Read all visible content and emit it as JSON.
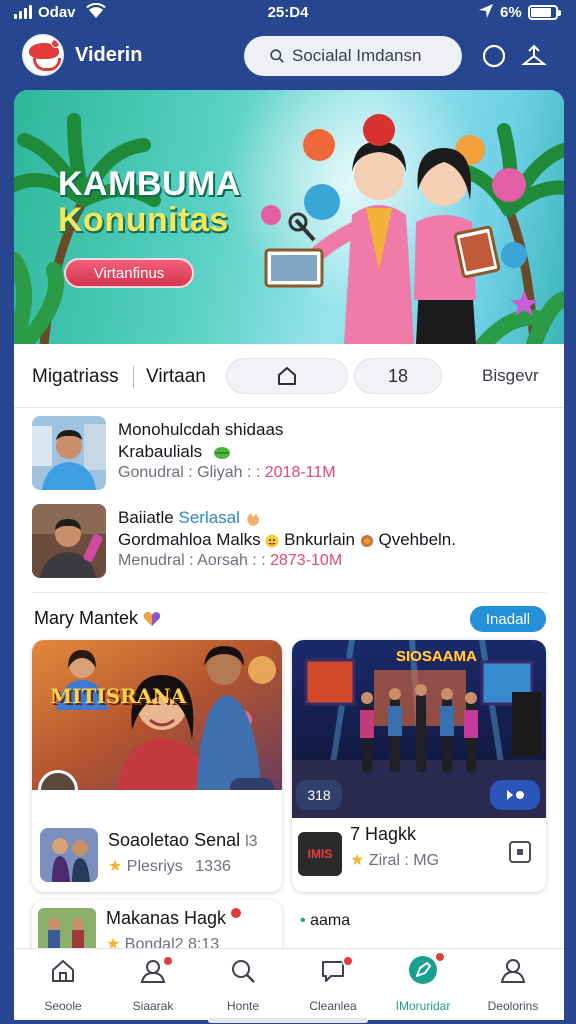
{
  "status_bar": {
    "carrier": "Odav",
    "time": "25:D4",
    "battery_text": "6%",
    "battery_level": 0.85
  },
  "header": {
    "app_title": "Viderin",
    "search_placeholder": "Socialal Imdansn"
  },
  "banner": {
    "title_line1": "KAMBUMA",
    "title_line2": "Konunitas",
    "cta_label": "Virtanfinus"
  },
  "tabs": {
    "tab1": "Migatriass",
    "tab2": "Virtaan",
    "pill_count": "18",
    "tab3": "Bisgevr"
  },
  "feed": [
    {
      "title": "Monohulcdah shidaas",
      "subtitle": "Krabaulials",
      "meta_label": "Gonudral : Gliyah : :",
      "meta_value": "2018-11M"
    },
    {
      "title_a": "Baiiatle",
      "title_b": "Serlasal",
      "subtitle": "Gordmahloa Malks",
      "subtitle_b": "Bnkurlain",
      "subtitle_c": "Qvehbeln.",
      "meta_label": "Menudral : Aorsah : :",
      "meta_value": "2873-10M"
    }
  ],
  "section": {
    "title": "Mary Mantek",
    "button_label": "Inadall"
  },
  "cards": [
    {
      "image_text": "MITISRANA",
      "title": "Soaoletao Senal",
      "title_suffix": "l3",
      "subtitle": "Plesriys",
      "subtitle_count": "1336"
    },
    {
      "image_text": "SIOSAAMA",
      "badge": "318",
      "title": "7 Hagkk",
      "thumb_text": "IMIS",
      "subtitle": "Ziral : MG"
    },
    {
      "title": "Makanas Hagk",
      "subtitle": "Bondal2 8:13"
    },
    {
      "title": "aama"
    }
  ],
  "bottom_nav": [
    {
      "label": "Seoole",
      "icon": "home-icon"
    },
    {
      "label": "Siaarak",
      "icon": "profile-icon"
    },
    {
      "label": "Honte",
      "icon": "search-icon"
    },
    {
      "label": "Cleanlea",
      "icon": "chat-icon"
    },
    {
      "label": "IMoruridar",
      "icon": "create-icon"
    },
    {
      "label": "Deolorins",
      "icon": "account-icon"
    }
  ],
  "colors": {
    "background": "#26468f",
    "accent": "#2390d8",
    "active_nav": "#1aa08e",
    "badge": "#e23b3b",
    "highlight_text": "#e0497a"
  }
}
